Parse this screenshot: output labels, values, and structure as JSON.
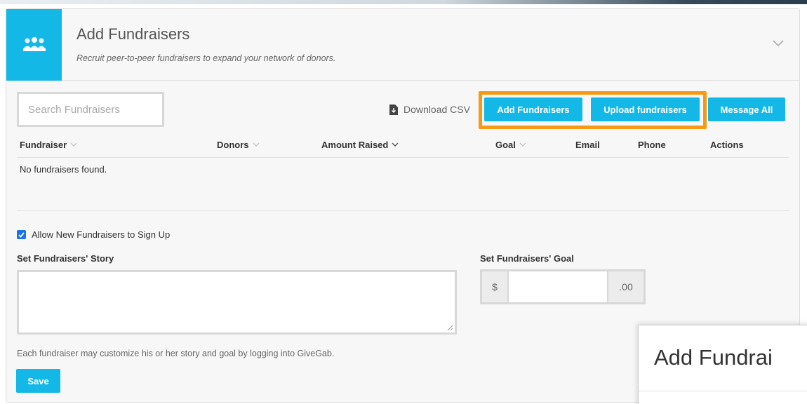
{
  "header": {
    "icon": "group-icon",
    "title": "Add Fundraisers",
    "subtitle": "Recruit peer-to-peer fundraisers to expand your network of donors."
  },
  "toolbar": {
    "search_placeholder": "Search Fundraisers",
    "download_csv": "Download CSV",
    "add_fundraisers": "Add Fundraisers",
    "upload_fundraisers": "Upload fundraisers",
    "message_all": "Message All",
    "highlight_color": "#f59a12"
  },
  "table": {
    "columns": [
      "Fundraiser",
      "Donors",
      "Amount Raised",
      "Goal",
      "Email",
      "Phone",
      "Actions"
    ],
    "empty_message": "No fundraisers found."
  },
  "settings": {
    "allow_signup_label": "Allow New Fundraisers to Sign Up",
    "allow_signup_checked": true,
    "story_label": "Set Fundraisers' Story",
    "story_value": "",
    "goal_label": "Set Fundraisers' Goal",
    "goal_prefix": "$",
    "goal_value": "",
    "goal_suffix": ".00",
    "note": "Each fundraiser may customize his or her story and goal by logging into GiveGab.",
    "save_label": "Save"
  },
  "zoom_callout": {
    "title": "Add Fundrai"
  },
  "colors": {
    "accent": "#14b8e6",
    "panel_bg": "#f7f7f7"
  }
}
